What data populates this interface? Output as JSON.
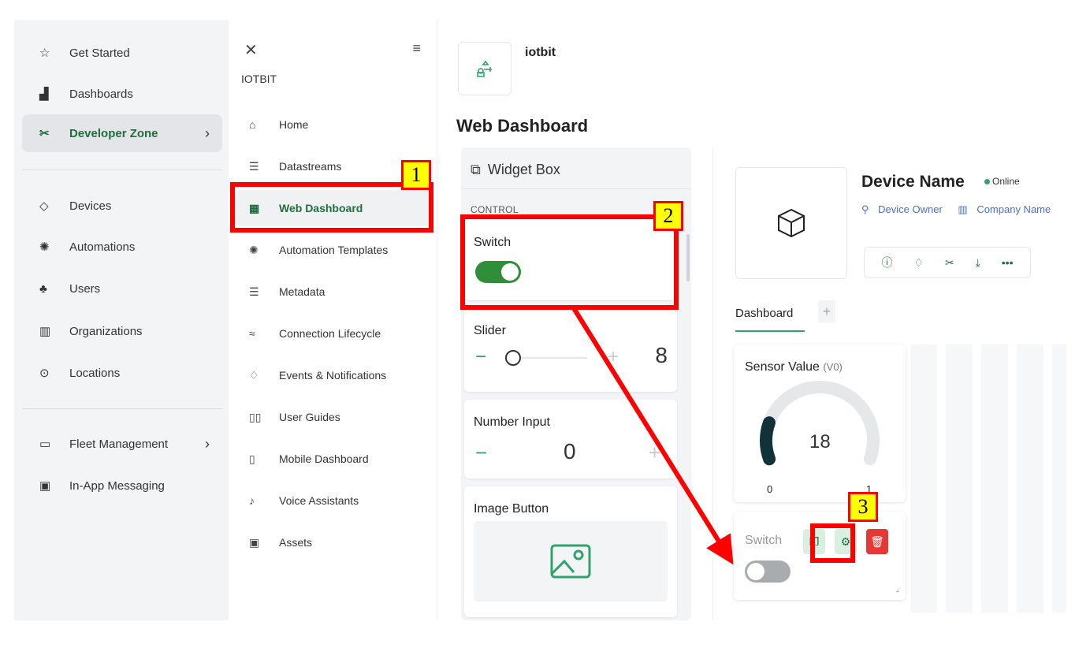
{
  "left_nav": {
    "items": [
      {
        "label": "Get Started",
        "icon": "star-icon"
      },
      {
        "label": "Dashboards",
        "icon": "bar-chart-icon"
      },
      {
        "label": "Developer Zone",
        "icon": "tools-icon",
        "active": true
      },
      {
        "label": "Devices",
        "icon": "cube-icon"
      },
      {
        "label": "Automations",
        "icon": "automation-icon"
      },
      {
        "label": "Users",
        "icon": "users-icon"
      },
      {
        "label": "Organizations",
        "icon": "building-icon"
      },
      {
        "label": "Locations",
        "icon": "location-pin-icon"
      },
      {
        "label": "Fleet Management",
        "icon": "truck-icon"
      },
      {
        "label": "In-App Messaging",
        "icon": "message-icon"
      }
    ]
  },
  "sub_nav": {
    "brand": "IOTBIT",
    "items": [
      {
        "label": "Home",
        "icon": "home-icon"
      },
      {
        "label": "Datastreams",
        "icon": "datastreams-icon"
      },
      {
        "label": "Web Dashboard",
        "icon": "web-dashboard-icon",
        "active": true
      },
      {
        "label": "Automation Templates",
        "icon": "automation-icon"
      },
      {
        "label": "Metadata",
        "icon": "list-icon"
      },
      {
        "label": "Connection Lifecycle",
        "icon": "wifi-icon"
      },
      {
        "label": "Events & Notifications",
        "icon": "bell-icon"
      },
      {
        "label": "User Guides",
        "icon": "book-icon"
      },
      {
        "label": "Mobile Dashboard",
        "icon": "phone-icon"
      },
      {
        "label": "Voice Assistants",
        "icon": "microphone-icon"
      },
      {
        "label": "Assets",
        "icon": "folder-icon"
      }
    ]
  },
  "main": {
    "template_name": "iotbit",
    "page_title": "Web Dashboard"
  },
  "widget_box": {
    "title": "Widget Box",
    "category": "CONTROL",
    "widgets": {
      "switch": "Switch",
      "slider": "Slider",
      "slider_value": "8",
      "number_input": "Number Input",
      "number_value": "0",
      "image_button": "Image Button"
    }
  },
  "device": {
    "name": "Device Name",
    "status": "Online",
    "owner": "Device Owner",
    "company": "Company Name"
  },
  "dashboard": {
    "tab": "Dashboard",
    "add_tab": "+",
    "gauge": {
      "title": "Sensor Value",
      "pin": "(V0)",
      "value": 18,
      "min": "0",
      "max": "1",
      "fraction": 0.18
    },
    "switch_widget": {
      "title": "Switch",
      "state": "off"
    }
  },
  "annotations": [
    "1",
    "2",
    "3"
  ],
  "colors": {
    "accent": "#2fa36b",
    "active_text": "#1f6e3f",
    "annotation": "#ff0000",
    "badge": "#ffff00",
    "link": "#4a6fc7"
  }
}
